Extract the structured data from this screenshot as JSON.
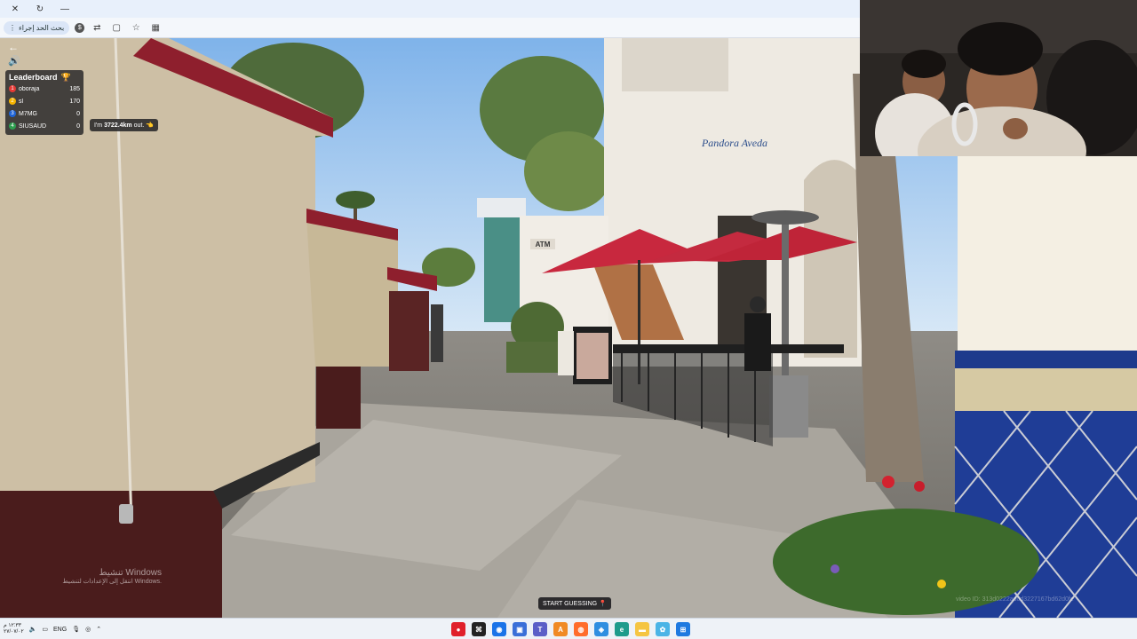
{
  "browser": {
    "extension_label": "بحث الحد إجراء",
    "extension_badge": "$",
    "icons": [
      "close-icon",
      "refresh-icon",
      "minimize-icon",
      "menu-dots-icon",
      "translate-icon",
      "split-icon",
      "star-icon"
    ]
  },
  "game": {
    "leaderboard": {
      "title": "Leaderboard",
      "trophy": "🏆",
      "rows": [
        {
          "rank": "1",
          "name": "oboraja",
          "score": "185",
          "color": "#e53935"
        },
        {
          "rank": "2",
          "name": "sl",
          "score": "170",
          "color": "#f5b400"
        },
        {
          "rank": "3",
          "name": "M7MG",
          "score": "0",
          "color": "#1e63d6"
        },
        {
          "rank": "4",
          "name": "SIUSAUD",
          "score": "0",
          "color": "#2e9e4f"
        }
      ]
    },
    "distance": {
      "prefix": "I'm",
      "value": "3722.4km",
      "suffix": "out.",
      "emoji": "👈"
    },
    "start_button": "START GUESSING",
    "back_glyph": "←",
    "sound_glyph": "🔊"
  },
  "scene": {
    "shop_sign": "Pandora Aveda",
    "atm_sign": "ATM"
  },
  "watermark": {
    "title": "تنشيط Windows",
    "subtitle": "انتقل إلى الإعدادات لتنشيط Windows."
  },
  "stream_id": "video ID: 313d0222ad0d3227167bd62d0fe",
  "taskbar": {
    "time": "١٢:٣٣ م",
    "date": "٢٧/٠٧/٠٢",
    "lang": "ENG",
    "apps": [
      {
        "name": "opera-icon",
        "glyph": "●",
        "color": "#e0202a"
      },
      {
        "name": "capcut-icon",
        "glyph": "⌘",
        "color": "#222222"
      },
      {
        "name": "chrome-icon",
        "glyph": "◉",
        "color": "#1a73e8"
      },
      {
        "name": "store-icon",
        "glyph": "▣",
        "color": "#3a6fd8"
      },
      {
        "name": "teams-icon",
        "glyph": "T",
        "color": "#5b5fc7"
      },
      {
        "name": "office-icon",
        "glyph": "A",
        "color": "#f08a24"
      },
      {
        "name": "firefox-icon",
        "glyph": "◍",
        "color": "#ff6d2b"
      },
      {
        "name": "photos-icon",
        "glyph": "◈",
        "color": "#2f8ee0"
      },
      {
        "name": "edge-icon",
        "glyph": "e",
        "color": "#1e9b8b"
      },
      {
        "name": "explorer-icon",
        "glyph": "▬",
        "color": "#f5c542"
      },
      {
        "name": "paint-icon",
        "glyph": "✿",
        "color": "#4bb4e6"
      },
      {
        "name": "start-icon",
        "glyph": "⊞",
        "color": "#1f7ae0"
      }
    ]
  }
}
